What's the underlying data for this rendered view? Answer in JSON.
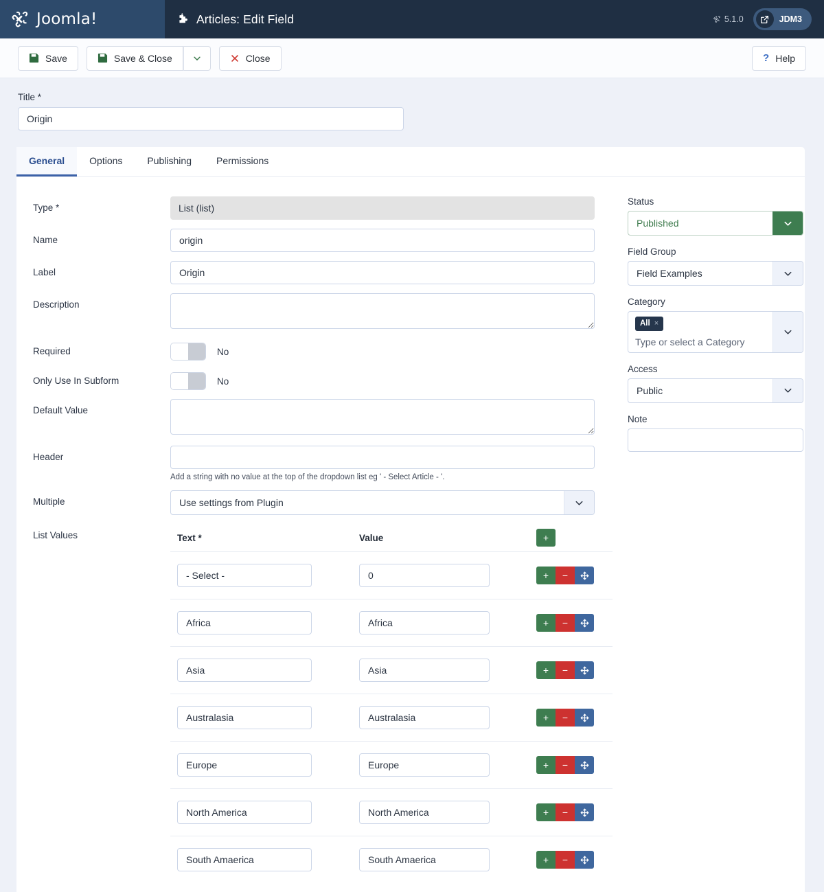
{
  "header": {
    "brand": "Joomla!",
    "title": "Articles: Edit Field",
    "version": "5.1.0",
    "user": "JDM3"
  },
  "toolbar": {
    "save_label": "Save",
    "save_close_label": "Save & Close",
    "close_label": "Close",
    "help_label": "Help"
  },
  "title_field": {
    "label": "Title *",
    "value": "Origin"
  },
  "tabs": [
    {
      "label": "General",
      "active": true
    },
    {
      "label": "Options",
      "active": false
    },
    {
      "label": "Publishing",
      "active": false
    },
    {
      "label": "Permissions",
      "active": false
    }
  ],
  "form": {
    "type": {
      "label": "Type *",
      "value": "List (list)"
    },
    "name": {
      "label": "Name",
      "value": "origin"
    },
    "field_label": {
      "label": "Label",
      "value": "Origin"
    },
    "description": {
      "label": "Description",
      "value": ""
    },
    "required": {
      "label": "Required",
      "value": "No"
    },
    "only_use_in_subform": {
      "label": "Only Use In Subform",
      "value": "No"
    },
    "default_value": {
      "label": "Default Value",
      "value": ""
    },
    "header": {
      "label": "Header",
      "value": "",
      "help": "Add a string with no value at the top of the dropdown list eg ' - Select Article - '."
    },
    "multiple": {
      "label": "Multiple",
      "value": "Use settings from Plugin"
    },
    "list_values": {
      "label": "List Values",
      "columns": {
        "text": "Text *",
        "value": "Value"
      },
      "add_label": "+",
      "row_buttons": {
        "add": "+",
        "remove": "−",
        "move": "move-icon"
      },
      "rows": [
        {
          "text": "- Select -",
          "value": "0"
        },
        {
          "text": "Africa",
          "value": "Africa"
        },
        {
          "text": "Asia",
          "value": "Asia"
        },
        {
          "text": "Australasia",
          "value": "Australasia"
        },
        {
          "text": "Europe",
          "value": "Europe"
        },
        {
          "text": "North America",
          "value": "North America"
        },
        {
          "text": "South Amaerica",
          "value": "South Amaerica"
        }
      ]
    }
  },
  "sidebar": {
    "status": {
      "label": "Status",
      "value": "Published"
    },
    "field_group": {
      "label": "Field Group",
      "value": "Field Examples"
    },
    "category": {
      "label": "Category",
      "chip": "All",
      "chip_remove": "×",
      "placeholder": "Type or select a Category"
    },
    "access": {
      "label": "Access",
      "value": "Public"
    },
    "note": {
      "label": "Note",
      "value": ""
    }
  },
  "colors": {
    "header_logo_bg": "#2d4a6b",
    "header_bg": "#1f2f43",
    "page_bg": "#eef1f8",
    "accent_blue": "#2a4d8f",
    "green": "#3e7d50",
    "red": "#cd3230",
    "blue_btn": "#3f679e"
  }
}
